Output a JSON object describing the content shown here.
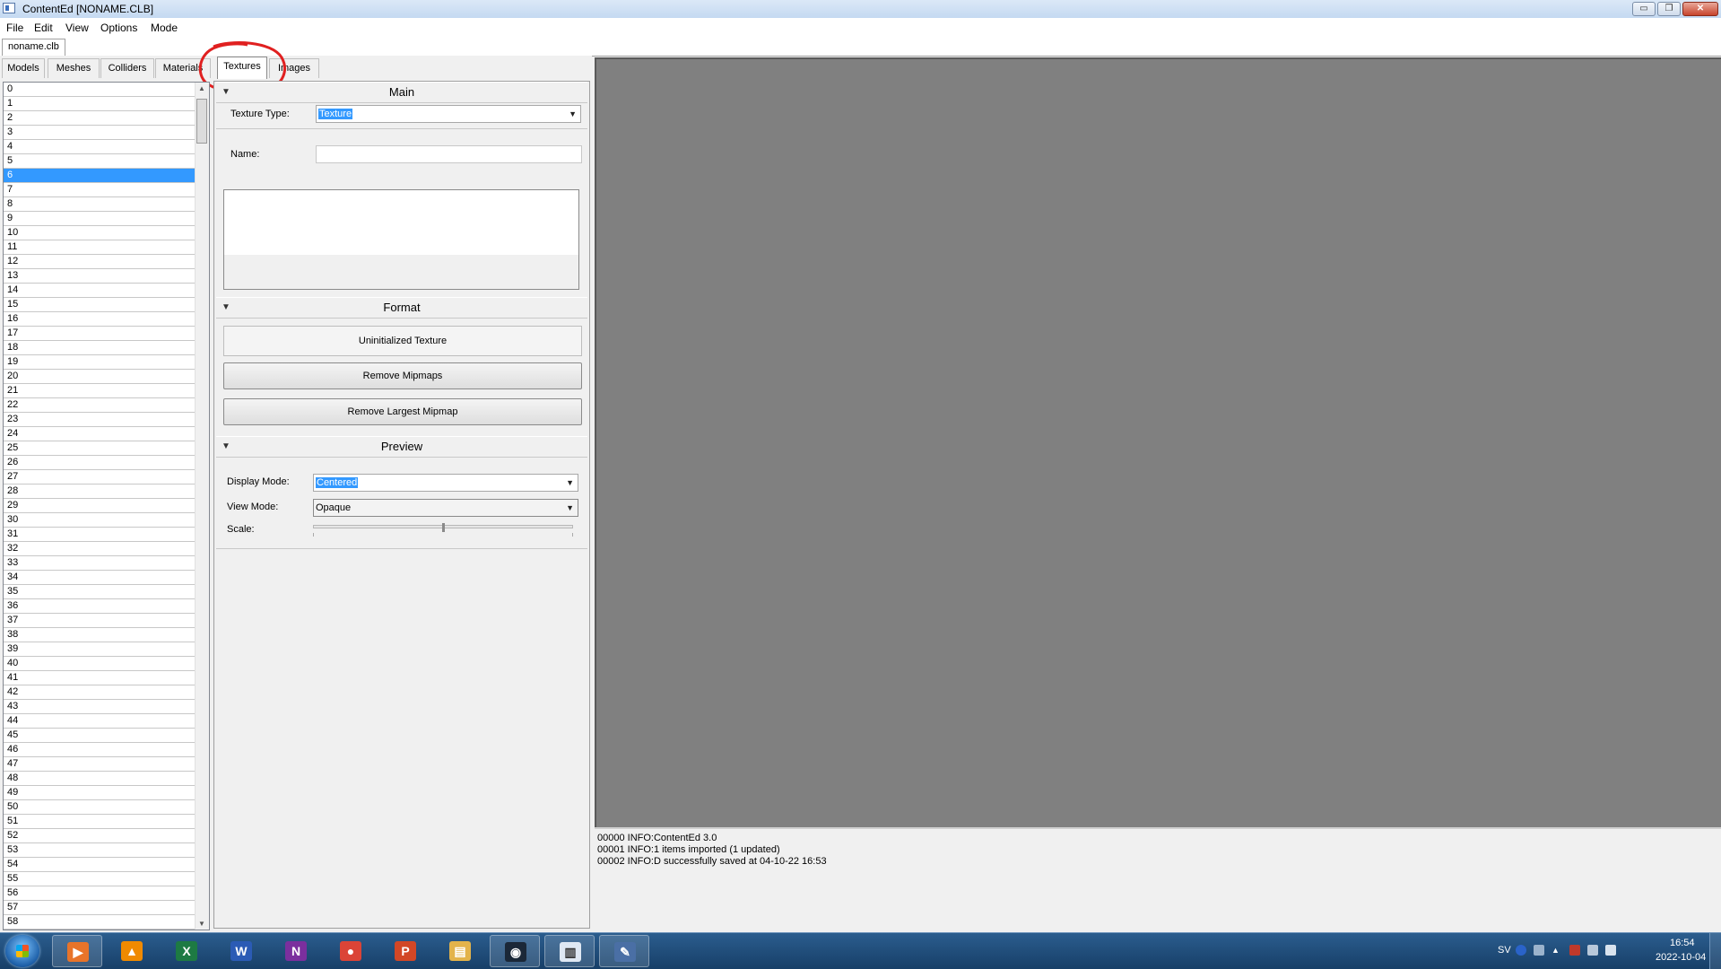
{
  "window": {
    "title": "ContentEd [NONAME.CLB]",
    "min_label": "▭",
    "max_label": "❐",
    "close_label": "✕"
  },
  "menu": [
    "File",
    "Edit",
    "View",
    "Options",
    "Mode"
  ],
  "document_tab": "noname.clb",
  "category_tabs": [
    {
      "label": "Models",
      "active": false
    },
    {
      "label": "Meshes",
      "active": false
    },
    {
      "label": "Colliders",
      "active": false
    },
    {
      "label": "Materials",
      "active": false
    },
    {
      "label": "Textures",
      "active": true
    },
    {
      "label": "Images",
      "active": false
    }
  ],
  "index_list": {
    "count": 59,
    "selected_index": 6
  },
  "sections": {
    "main": {
      "title": "Main",
      "texture_type_label": "Texture Type:",
      "texture_type_value": "Texture",
      "name_label": "Name:",
      "name_value": ""
    },
    "format": {
      "title": "Format",
      "status_text": "Uninitialized Texture",
      "remove_mipmaps": "Remove Mipmaps",
      "remove_largest_mipmap": "Remove Largest Mipmap"
    },
    "preview": {
      "title": "Preview",
      "display_mode_label": "Display Mode:",
      "display_mode_value": "Centered",
      "view_mode_label": "View Mode:",
      "view_mode_value": "Opaque",
      "scale_label": "Scale:",
      "scale_fraction": 0.5
    }
  },
  "log": [
    "00000 INFO:ContentEd 3.0",
    "00001 INFO:1 items imported (1 updated)",
    "00002 INFO:D successfully saved at 04-10-22 16:53"
  ],
  "taskbar": {
    "apps": [
      {
        "name": "media-player",
        "letter": "▶",
        "color": "#e8742a",
        "open": true
      },
      {
        "name": "vlc",
        "letter": "▲",
        "color": "#f08a00",
        "open": false
      },
      {
        "name": "excel",
        "letter": "X",
        "color": "#1d7a43",
        "open": false
      },
      {
        "name": "word",
        "letter": "W",
        "color": "#2b5bb5",
        "open": false
      },
      {
        "name": "onenote",
        "letter": "N",
        "color": "#7b2f9e",
        "open": false
      },
      {
        "name": "chrome",
        "letter": "●",
        "color": "#db4437",
        "open": false
      },
      {
        "name": "powerpoint",
        "letter": "P",
        "color": "#d24726",
        "open": false
      },
      {
        "name": "explorer",
        "letter": "▤",
        "color": "#e3b34b",
        "open": false
      },
      {
        "name": "steam",
        "letter": "◉",
        "color": "#1b2838",
        "open": true
      },
      {
        "name": "contented",
        "letter": "▥",
        "color": "#dfe8f3",
        "open": true
      },
      {
        "name": "editor",
        "letter": "✎",
        "color": "#4a6fa5",
        "open": true
      }
    ],
    "language": "SV",
    "time": "16:54",
    "date": "2022-10-04"
  },
  "colors": {
    "selection": "#3399ff",
    "viewport": "#808080",
    "highlight_circle": "#e02020"
  }
}
